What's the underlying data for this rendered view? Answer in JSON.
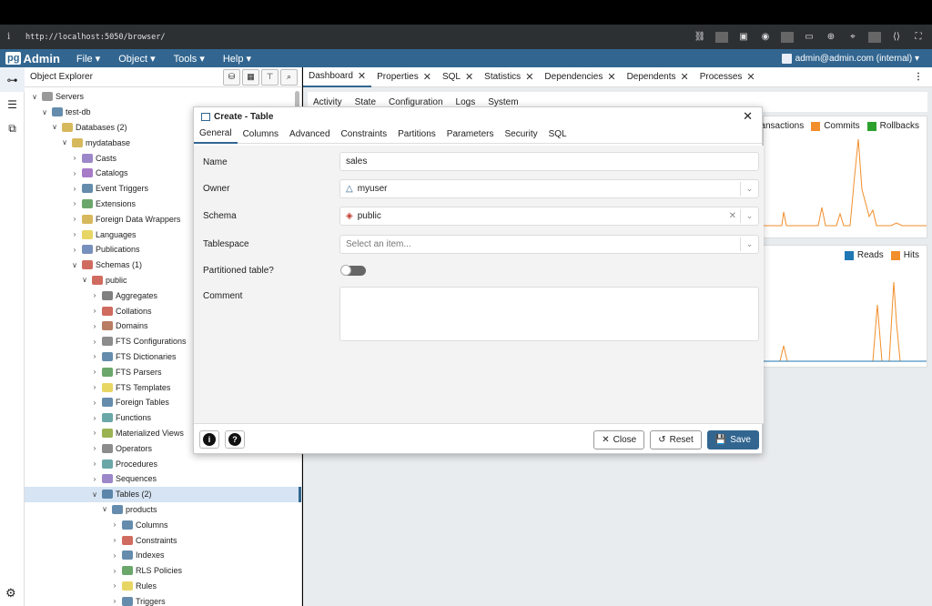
{
  "browser": {
    "url": "http://localhost:5050/browser/"
  },
  "app": {
    "logo_pg": "pg",
    "logo_admin": "Admin"
  },
  "menu": [
    {
      "label": "File ▾"
    },
    {
      "label": "Object ▾"
    },
    {
      "label": "Tools ▾"
    },
    {
      "label": "Help ▾"
    }
  ],
  "user": "admin@admin.com (internal) ▾",
  "explorer": {
    "title": "Object Explorer",
    "nodes": [
      {
        "label": "Servers",
        "depth": 0,
        "chev": "∨",
        "color": "#777777"
      },
      {
        "label": "test-db",
        "depth": 1,
        "chev": "∨",
        "color": "#326690"
      },
      {
        "label": "Databases (2)",
        "depth": 2,
        "chev": "∨",
        "color": "#c9a227"
      },
      {
        "label": "mydatabase",
        "depth": 3,
        "chev": "∨",
        "color": "#c9a227"
      },
      {
        "label": "Casts",
        "depth": 4,
        "chev": "›",
        "color": "#7b5fb5"
      },
      {
        "label": "Catalogs",
        "depth": 4,
        "chev": "›",
        "color": "#8a4fb5"
      },
      {
        "label": "Event Triggers",
        "depth": 4,
        "chev": "›",
        "color": "#326690"
      },
      {
        "label": "Extensions",
        "depth": 4,
        "chev": "›",
        "color": "#3a8a3a"
      },
      {
        "label": "Foreign Data Wrappers",
        "depth": 4,
        "chev": "›",
        "color": "#c9a227"
      },
      {
        "label": "Languages",
        "depth": 4,
        "chev": "›",
        "color": "#e0c830"
      },
      {
        "label": "Publications",
        "depth": 4,
        "chev": "›",
        "color": "#4a6aa5"
      },
      {
        "label": "Schemas (1)",
        "depth": 4,
        "chev": "∨",
        "color": "#c0392b"
      },
      {
        "label": "public",
        "depth": 5,
        "chev": "∨",
        "color": "#c0392b"
      },
      {
        "label": "Aggregates",
        "depth": 6,
        "chev": "›",
        "color": "#555555"
      },
      {
        "label": "Collations",
        "depth": 6,
        "chev": "›",
        "color": "#c0392b"
      },
      {
        "label": "Domains",
        "depth": 6,
        "chev": "›",
        "color": "#a0522d"
      },
      {
        "label": "FTS Configurations",
        "depth": 6,
        "chev": "›",
        "color": "#666666"
      },
      {
        "label": "FTS Dictionaries",
        "depth": 6,
        "chev": "›",
        "color": "#326690"
      },
      {
        "label": "FTS Parsers",
        "depth": 6,
        "chev": "›",
        "color": "#3a8a3a"
      },
      {
        "label": "FTS Templates",
        "depth": 6,
        "chev": "›",
        "color": "#e0c830"
      },
      {
        "label": "Foreign Tables",
        "depth": 6,
        "chev": "›",
        "color": "#326690"
      },
      {
        "label": "Functions",
        "depth": 6,
        "chev": "›",
        "color": "#3a8a8a"
      },
      {
        "label": "Materialized Views",
        "depth": 6,
        "chev": "›",
        "color": "#7a9a1a"
      },
      {
        "label": "Operators",
        "depth": 6,
        "chev": "›",
        "color": "#666666"
      },
      {
        "label": "Procedures",
        "depth": 6,
        "chev": "›",
        "color": "#3a8a8a"
      },
      {
        "label": "Sequences",
        "depth": 6,
        "chev": "›",
        "color": "#7b5fb5"
      },
      {
        "label": "Tables (2)",
        "depth": 6,
        "chev": "∨",
        "color": "#326690",
        "selected": true
      },
      {
        "label": "products",
        "depth": 7,
        "chev": "∨",
        "color": "#326690"
      },
      {
        "label": "Columns",
        "depth": 8,
        "chev": "›",
        "color": "#326690"
      },
      {
        "label": "Constraints",
        "depth": 8,
        "chev": "›",
        "color": "#c0392b"
      },
      {
        "label": "Indexes",
        "depth": 8,
        "chev": "›",
        "color": "#326690"
      },
      {
        "label": "RLS Policies",
        "depth": 8,
        "chev": "›",
        "color": "#3a8a3a"
      },
      {
        "label": "Rules",
        "depth": 8,
        "chev": "›",
        "color": "#e0c830"
      },
      {
        "label": "Triggers",
        "depth": 8,
        "chev": "›",
        "color": "#326690"
      }
    ]
  },
  "tabs": [
    {
      "label": "Dashboard",
      "active": true
    },
    {
      "label": "Properties"
    },
    {
      "label": "SQL"
    },
    {
      "label": "Statistics"
    },
    {
      "label": "Dependencies"
    },
    {
      "label": "Dependents"
    },
    {
      "label": "Processes"
    }
  ],
  "subtabs": [
    "Activity",
    "State",
    "Configuration",
    "Logs",
    "System"
  ],
  "chart1_legend": [
    {
      "label": "Transactions",
      "color": "#2c7fb8"
    },
    {
      "label": "Commits",
      "color": "#f28e2b"
    },
    {
      "label": "Rollbacks",
      "color": "#2ca02c"
    }
  ],
  "chart2_legend": [
    {
      "label": "Reads",
      "color": "#1f77b4"
    },
    {
      "label": "Hits",
      "color": "#f28e2b"
    }
  ],
  "dialog": {
    "title": "Create - Table",
    "tabs": [
      "General",
      "Columns",
      "Advanced",
      "Constraints",
      "Partitions",
      "Parameters",
      "Security",
      "SQL"
    ],
    "fields": {
      "name_label": "Name",
      "name_value": "sales",
      "owner_label": "Owner",
      "owner_value": "myuser",
      "schema_label": "Schema",
      "schema_value": "public",
      "tablespace_label": "Tablespace",
      "tablespace_placeholder": "Select an item...",
      "partitioned_label": "Partitioned table?",
      "comment_label": "Comment"
    },
    "buttons": {
      "close": "Close",
      "reset": "Reset",
      "save": "Save"
    }
  }
}
